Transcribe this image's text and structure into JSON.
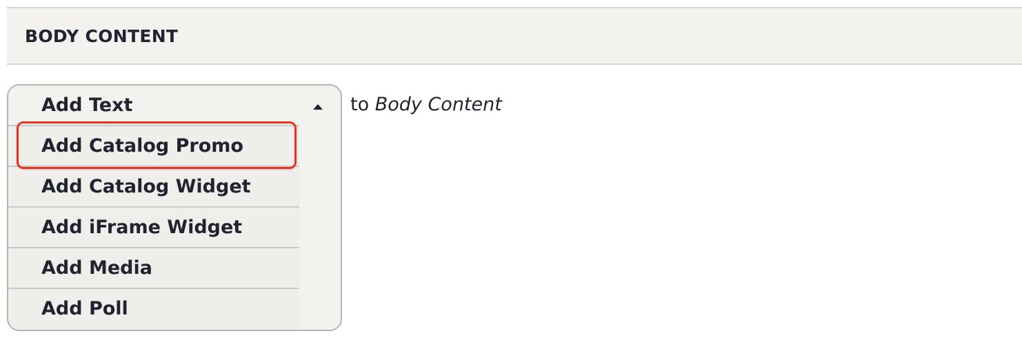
{
  "section": {
    "title": "BODY CONTENT"
  },
  "dropbutton": {
    "items": [
      {
        "label": "Add Text"
      },
      {
        "label": "Add Catalog Promo"
      },
      {
        "label": "Add Catalog Widget"
      },
      {
        "label": "Add iFrame Widget"
      },
      {
        "label": "Add Media"
      },
      {
        "label": "Add Poll"
      }
    ],
    "toggle_icon": "caret-up-icon",
    "highlighted_item": "Add Catalog Promo"
  },
  "suffix": {
    "prefix": "to",
    "target": "Body Content"
  },
  "colors": {
    "highlight": "#e8331f",
    "header_background": "#f3f2ef",
    "text": "#222330"
  }
}
